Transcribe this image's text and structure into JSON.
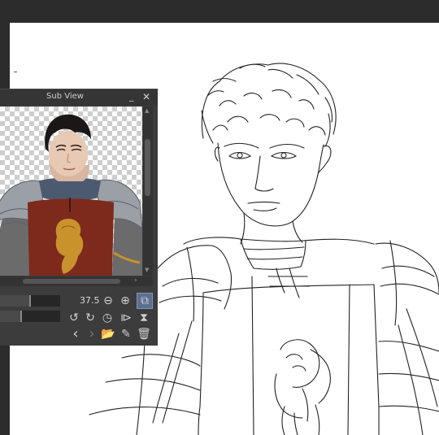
{
  "subview": {
    "title": "Sub View",
    "minimize_glyph": "_",
    "close_glyph": "✕",
    "zoom_value": "37.5",
    "zoom_level": 0.5,
    "rotation_level": 0.35
  },
  "icons": {
    "zoom_out": "zoom-out-icon",
    "zoom_in": "zoom-in-icon",
    "fit": "fit-view-icon",
    "rotate_left": "rotate-left-icon",
    "rotate_right": "rotate-right-icon",
    "reset_rotation": "reset-rotation-icon",
    "flip_horizontal": "flip-horizontal-icon",
    "flip_vertical": "flip-vertical-icon",
    "previous": "chevron-left-icon",
    "next": "chevron-right-icon",
    "open": "folder-open-icon",
    "edit": "edit-icon",
    "delete": "trash-icon"
  },
  "colors": {
    "panel_bg": "#3c3c3c",
    "app_bg": "#2c2c2c",
    "canvas_bg": "#ffffff",
    "selected_button": "#5b6f8e",
    "armor_red": "#7d2a1c",
    "lion_gold": "#c9922c"
  }
}
